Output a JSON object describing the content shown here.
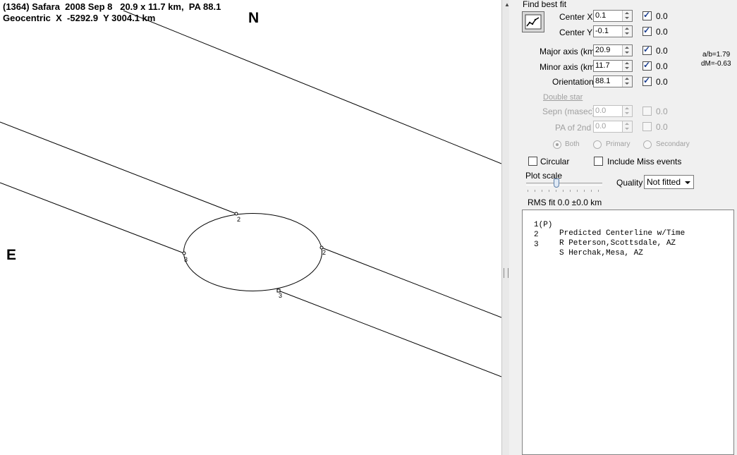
{
  "plot": {
    "title_line1": "(1364) Safara  2008 Sep 8   20.9 x 11.7 km,  PA 88.1",
    "title_line2": "Geocentric  X  -5292.9  Y 3004.1 km",
    "north_label": "N",
    "east_label": "E",
    "chord_labels": [
      "2",
      "2",
      "3",
      "3"
    ]
  },
  "panel": {
    "section_title": "Find best fit",
    "fit_rows": [
      {
        "label": "Center X",
        "value": "0.1",
        "checked": true,
        "delta": "0.0"
      },
      {
        "label": "Center Y",
        "value": "-0.1",
        "checked": true,
        "delta": "0.0"
      },
      {
        "label": "Major axis (km)",
        "value": "20.9",
        "checked": true,
        "delta": "0.0"
      },
      {
        "label": "Minor axis (km)",
        "value": "11.7",
        "checked": true,
        "delta": "0.0"
      },
      {
        "label": "Orientation",
        "value": "88.1",
        "checked": true,
        "delta": "0.0"
      }
    ],
    "ratio_text": "a/b=1.79",
    "dm_text": "dM=-0.63",
    "double_star": {
      "heading": "Double star",
      "rows": [
        {
          "label": "Sepn (masec)",
          "value": "0.0",
          "delta": "0.0"
        },
        {
          "label": "PA of 2nd",
          "value": "0.0",
          "delta": "0.0"
        }
      ],
      "radios": [
        "Both",
        "Primary",
        "Secondary"
      ],
      "selected": "Both"
    },
    "circular_label": "Circular",
    "include_miss_label": "Include Miss events",
    "plot_scale_label": "Plot scale",
    "plot_scale_level": 0.4,
    "quality_label": "Quality",
    "quality_value": "Not fitted",
    "rms_text": "RMS fit 0.0 ±0.0 km",
    "observers": [
      {
        "num": "1(P)",
        "text": "Predicted Centerline w/Time"
      },
      {
        "num": "2",
        "text": "R Peterson,Scottsdale, AZ"
      },
      {
        "num": "3",
        "text": "S Herchak,Mesa, AZ"
      }
    ]
  },
  "colors": {
    "panel_bg": "#f0f0f0",
    "check_blue": "#1a3d8f",
    "disabled_gray": "#a0a0a0"
  },
  "icons": {
    "fit_button": "fit-chart-icon",
    "splitter_grip": "grip-icon"
  }
}
